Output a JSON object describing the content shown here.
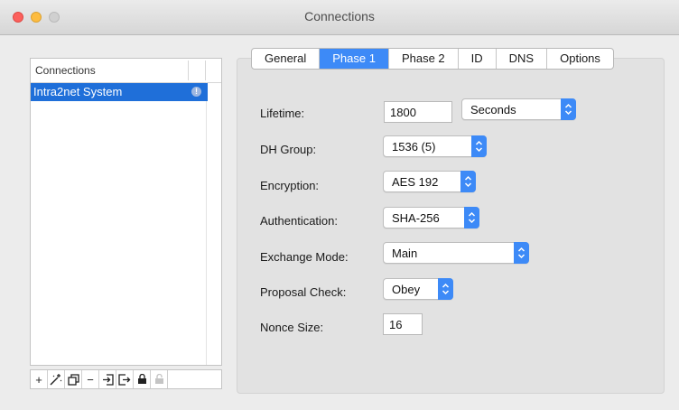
{
  "window": {
    "title": "Connections"
  },
  "connections": {
    "header": "Connections",
    "items": [
      {
        "label": "Intra2net System",
        "badge": "!"
      }
    ]
  },
  "toolbar": {
    "add": "+",
    "remove": "−"
  },
  "tabs": [
    "General",
    "Phase 1",
    "Phase 2",
    "ID",
    "DNS",
    "Options"
  ],
  "active_tab": "Phase 1",
  "form": {
    "lifetime": {
      "label": "Lifetime:",
      "value": "1800",
      "unit": "Seconds"
    },
    "dh_group": {
      "label": "DH Group:",
      "value": "1536 (5)"
    },
    "encryption": {
      "label": "Encryption:",
      "value": "AES 192"
    },
    "authentication": {
      "label": "Authentication:",
      "value": "SHA-256"
    },
    "exchange_mode": {
      "label": "Exchange Mode:",
      "value": "Main"
    },
    "proposal_check": {
      "label": "Proposal Check:",
      "value": "Obey"
    },
    "nonce_size": {
      "label": "Nonce Size:",
      "value": "16"
    }
  },
  "colors": {
    "accent": "#3d8af7",
    "selection": "#1f6fd9"
  }
}
